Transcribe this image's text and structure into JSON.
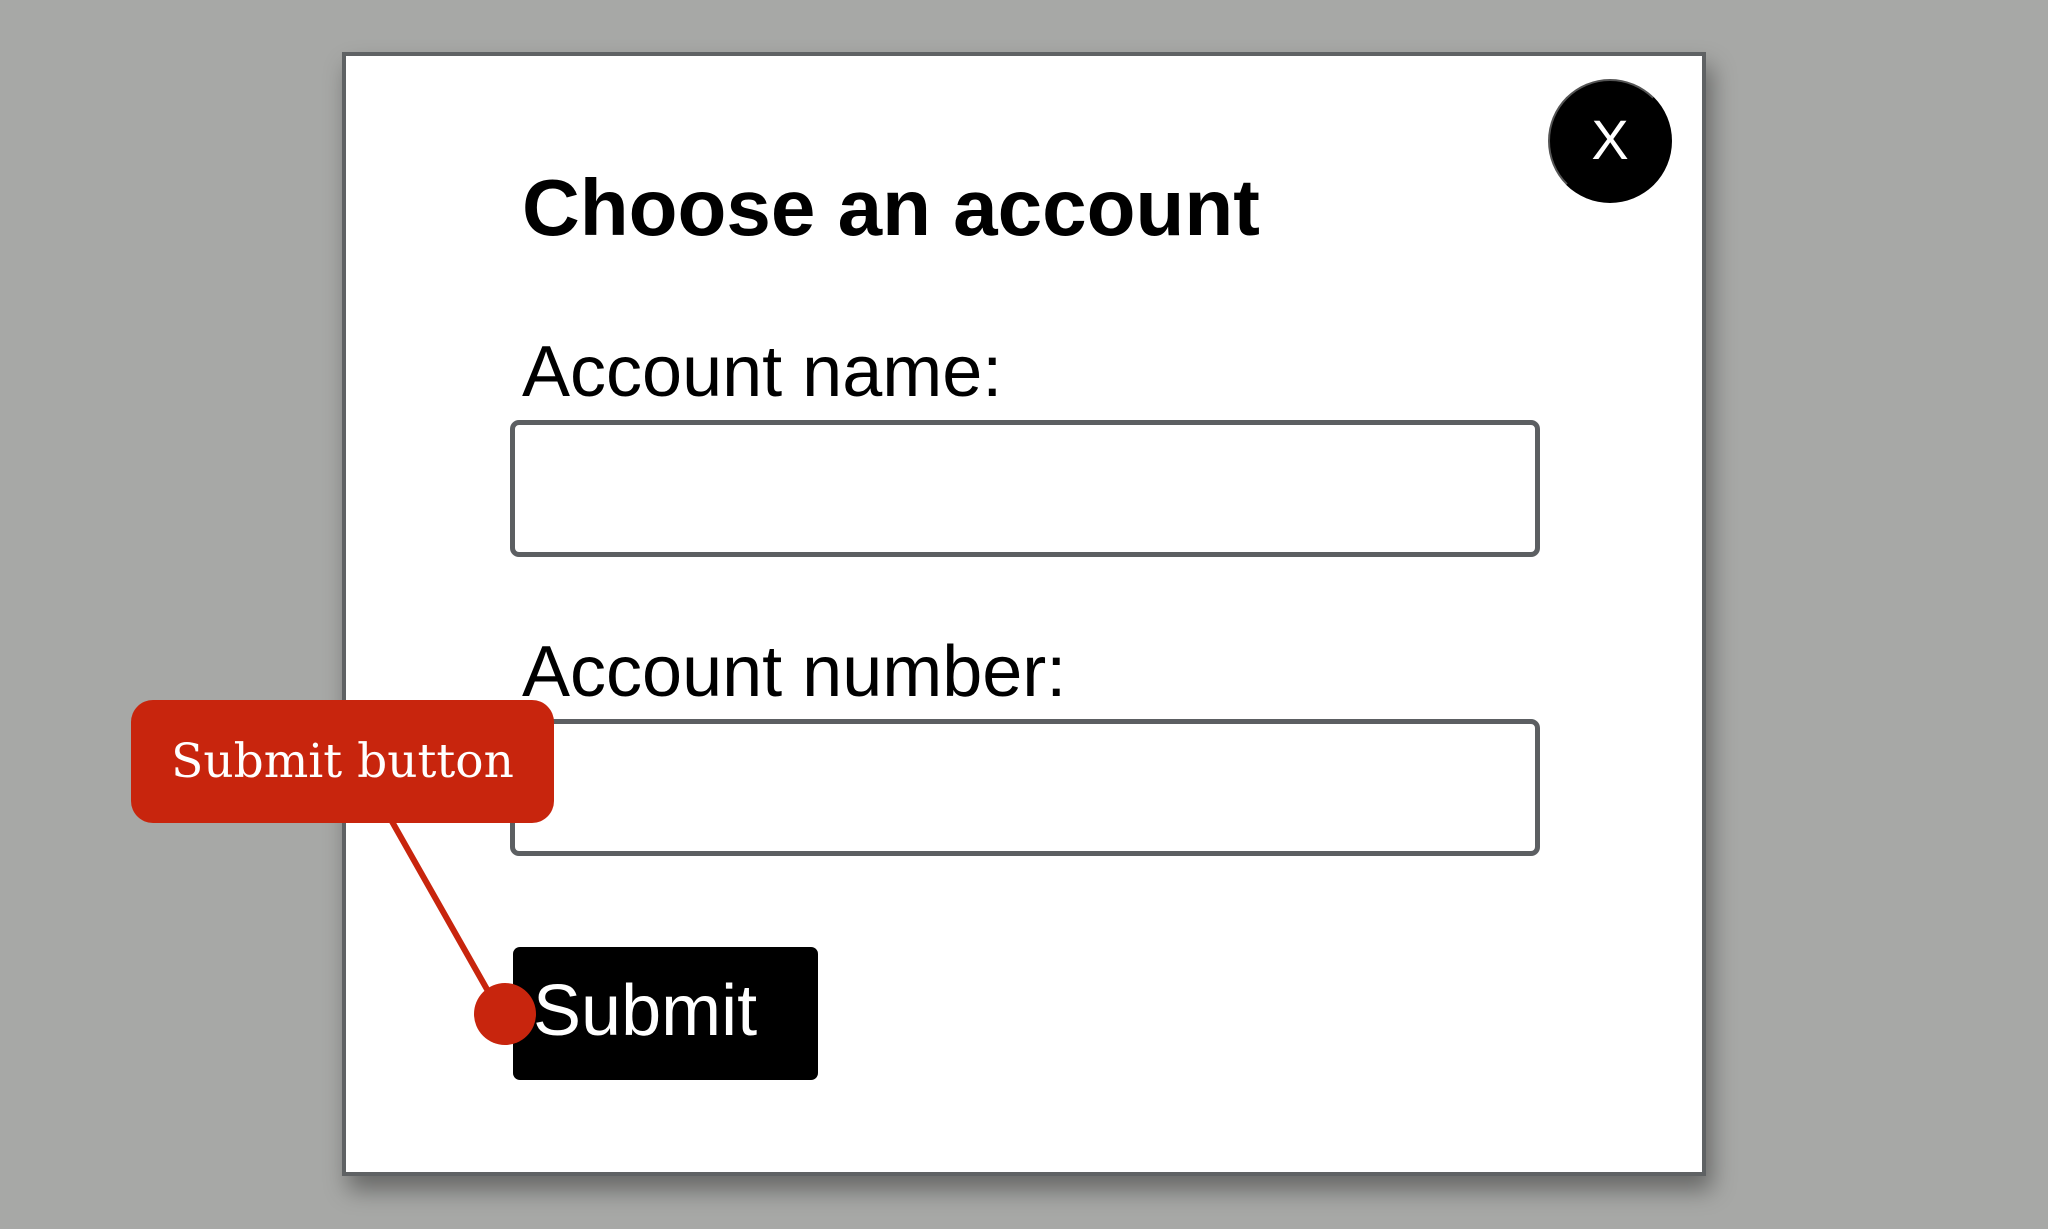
{
  "dialog": {
    "title": "Choose an account",
    "close_label": "X",
    "fields": [
      {
        "label": "Account name:",
        "value": ""
      },
      {
        "label": "Account number:",
        "value": ""
      }
    ],
    "submit_label": "Submit"
  },
  "annotation": {
    "label": "Submit button",
    "color": "#c8250d"
  },
  "colors": {
    "background": "#a7a8a6",
    "dialog_border": "#5f6264",
    "button_background": "#000000"
  }
}
